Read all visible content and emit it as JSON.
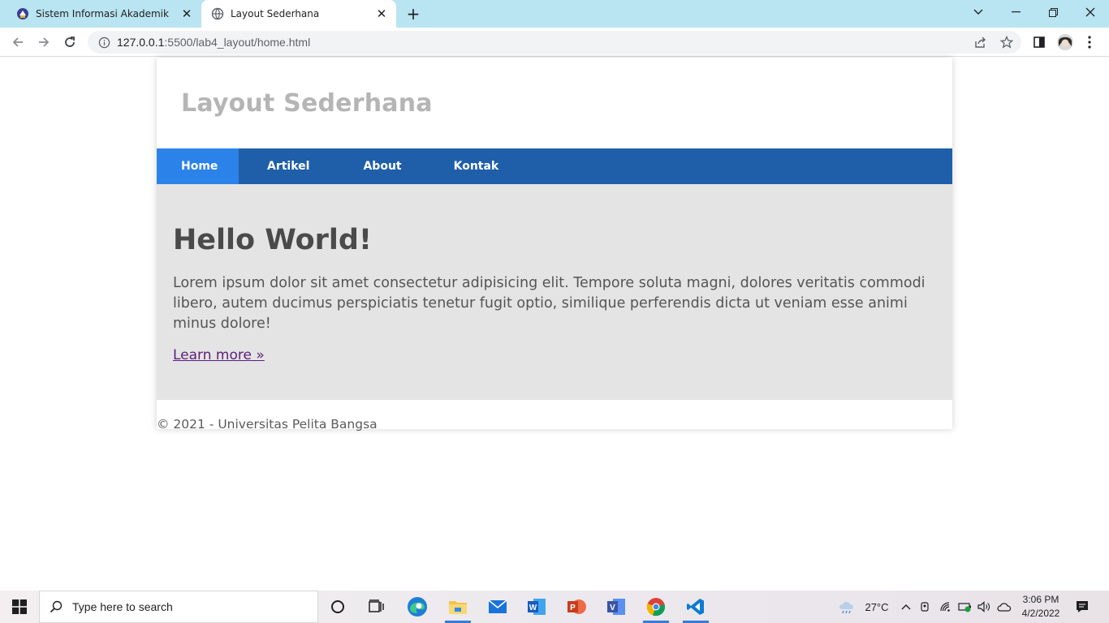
{
  "browser": {
    "tabs": [
      {
        "title": "Sistem Informasi Akademik",
        "active": false,
        "icon": "university-logo-icon"
      },
      {
        "title": "Layout Sederhana",
        "active": true,
        "icon": "globe-icon"
      }
    ],
    "url_host": "127.0.0.1",
    "url_rest": ":5500/lab4_layout/home.html"
  },
  "site": {
    "header_title": "Layout Sederhana",
    "nav": [
      {
        "label": "Home",
        "active": true
      },
      {
        "label": "Artikel",
        "active": false
      },
      {
        "label": "About",
        "active": false
      },
      {
        "label": "Kontak",
        "active": false
      }
    ],
    "hero": {
      "heading": "Hello World!",
      "paragraph": "Lorem ipsum dolor sit amet consectetur adipisicing elit. Tempore soluta magni, dolores veritatis commodi libero, autem ducimus perspiciatis tenetur fugit optio, similique perferendis dicta ut veniam esse animi minus dolore!",
      "link": "Learn more »"
    },
    "footer": "© 2021 - Universitas Pelita Bangsa"
  },
  "colors": {
    "nav_bg": "#1f5faa",
    "nav_active": "#2b83ea",
    "hero_bg": "#e4e4e4",
    "tabstrip_bg": "#b9e4f1"
  },
  "taskbar": {
    "search_placeholder": "Type here to search",
    "temperature": "27°C",
    "time": "3:06 PM",
    "date": "4/2/2022"
  }
}
